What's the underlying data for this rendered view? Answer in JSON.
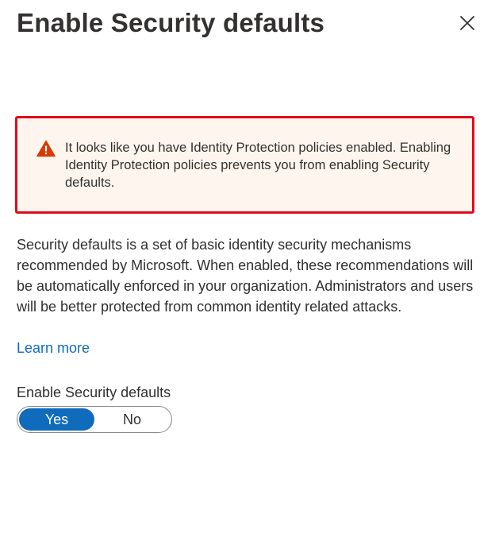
{
  "panel": {
    "title": "Enable Security defaults",
    "close_icon": "close-icon"
  },
  "warning": {
    "icon": "warning-icon",
    "color": "#d83b01",
    "border_color": "#e00b1c",
    "text": "It looks like you have Identity Protection policies enabled. Enabling Identity Protection policies prevents you from enabling Security defaults."
  },
  "description": "Security defaults is a set of basic identity security mechanisms recommended by Microsoft. When enabled, these recommendations will be automatically enforced in your organization. Administrators and users will be better protected from common identity related attacks.",
  "learn_more": "Learn more",
  "toggle": {
    "label": "Enable Security defaults",
    "options": [
      "Yes",
      "No"
    ],
    "selected": "Yes",
    "accent": "#0f6cbd"
  }
}
